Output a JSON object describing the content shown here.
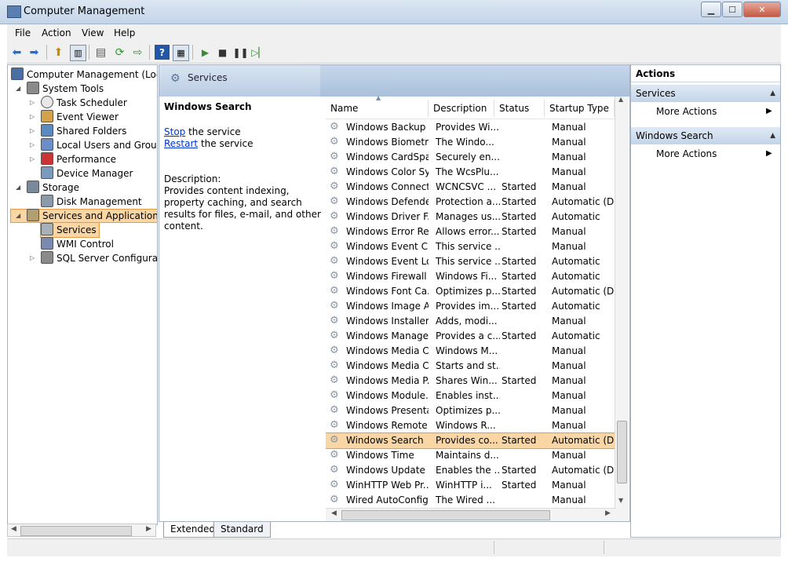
{
  "window": {
    "title": "Computer Management"
  },
  "menu": [
    "File",
    "Action",
    "View",
    "Help"
  ],
  "tree": {
    "items": [
      {
        "label": "Computer Management (Local",
        "icon": "computer-icon",
        "depth": 0,
        "expander": "none"
      },
      {
        "label": "System Tools",
        "icon": "tools-icon",
        "depth": 1,
        "expander": "expanded"
      },
      {
        "label": "Task Scheduler",
        "icon": "clock-icon",
        "depth": 2,
        "expander": "collapsed"
      },
      {
        "label": "Event Viewer",
        "icon": "event-viewer-icon",
        "depth": 2,
        "expander": "collapsed"
      },
      {
        "label": "Shared Folders",
        "icon": "shared-folder-icon",
        "depth": 2,
        "expander": "collapsed"
      },
      {
        "label": "Local Users and Groups",
        "icon": "users-icon",
        "depth": 2,
        "expander": "collapsed"
      },
      {
        "label": "Performance",
        "icon": "performance-icon",
        "depth": 2,
        "expander": "collapsed"
      },
      {
        "label": "Device Manager",
        "icon": "device-manager-icon",
        "depth": 2,
        "expander": "none"
      },
      {
        "label": "Storage",
        "icon": "storage-icon",
        "depth": 1,
        "expander": "expanded"
      },
      {
        "label": "Disk Management",
        "icon": "disk-icon",
        "depth": 2,
        "expander": "none"
      },
      {
        "label": "Services and Applications",
        "icon": "services-apps-icon",
        "depth": 1,
        "expander": "expanded",
        "highlight": true
      },
      {
        "label": "Services",
        "icon": "services-icon",
        "depth": 2,
        "expander": "none",
        "selected": true
      },
      {
        "label": "WMI Control",
        "icon": "wmi-icon",
        "depth": 2,
        "expander": "none"
      },
      {
        "label": "SQL Server Configuratic",
        "icon": "sql-icon",
        "depth": 2,
        "expander": "collapsed"
      }
    ]
  },
  "center": {
    "header_title": "Services",
    "selected_service": "Windows Search",
    "stop_link": "Stop",
    "stop_suffix": " the service",
    "restart_link": "Restart",
    "restart_suffix": " the service",
    "description_label": "Description:",
    "description_text": "Provides content indexing, property caching, and search results for files, e-mail, and other content."
  },
  "columns": [
    "Name",
    "Description",
    "Status",
    "Startup Type"
  ],
  "services": [
    {
      "name": "Windows Backup",
      "desc": "Provides Wi...",
      "status": "",
      "startup": "Manual"
    },
    {
      "name": "Windows Biometri...",
      "desc": "The Windo...",
      "status": "",
      "startup": "Manual"
    },
    {
      "name": "Windows CardSpa...",
      "desc": "Securely en...",
      "status": "",
      "startup": "Manual"
    },
    {
      "name": "Windows Color Sy...",
      "desc": "The WcsPlu...",
      "status": "",
      "startup": "Manual"
    },
    {
      "name": "Windows Connect...",
      "desc": "WCNCSVC ...",
      "status": "Started",
      "startup": "Manual"
    },
    {
      "name": "Windows Defender",
      "desc": "Protection a...",
      "status": "Started",
      "startup": "Automatic (D..."
    },
    {
      "name": "Windows Driver F...",
      "desc": "Manages us...",
      "status": "Started",
      "startup": "Automatic"
    },
    {
      "name": "Windows Error Re...",
      "desc": "Allows error...",
      "status": "Started",
      "startup": "Manual"
    },
    {
      "name": "Windows Event C...",
      "desc": "This service ...",
      "status": "",
      "startup": "Manual"
    },
    {
      "name": "Windows Event Log",
      "desc": "This service ...",
      "status": "Started",
      "startup": "Automatic"
    },
    {
      "name": "Windows Firewall",
      "desc": "Windows Fi...",
      "status": "Started",
      "startup": "Automatic"
    },
    {
      "name": "Windows Font Ca...",
      "desc": "Optimizes p...",
      "status": "Started",
      "startup": "Automatic (D..."
    },
    {
      "name": "Windows Image A...",
      "desc": "Provides im...",
      "status": "Started",
      "startup": "Automatic"
    },
    {
      "name": "Windows Installer",
      "desc": "Adds, modi...",
      "status": "",
      "startup": "Manual"
    },
    {
      "name": "Windows Manage...",
      "desc": "Provides a c...",
      "status": "Started",
      "startup": "Automatic"
    },
    {
      "name": "Windows Media C...",
      "desc": "Windows M...",
      "status": "",
      "startup": "Manual"
    },
    {
      "name": "Windows Media C...",
      "desc": "Starts and st...",
      "status": "",
      "startup": "Manual"
    },
    {
      "name": "Windows Media P...",
      "desc": "Shares Win...",
      "status": "Started",
      "startup": "Manual"
    },
    {
      "name": "Windows Module...",
      "desc": "Enables inst...",
      "status": "",
      "startup": "Manual"
    },
    {
      "name": "Windows Presenta...",
      "desc": "Optimizes p...",
      "status": "",
      "startup": "Manual"
    },
    {
      "name": "Windows Remote ...",
      "desc": "Windows R...",
      "status": "",
      "startup": "Manual"
    },
    {
      "name": "Windows Search",
      "desc": "Provides co...",
      "status": "Started",
      "startup": "Automatic (D...",
      "selected": true
    },
    {
      "name": "Windows Time",
      "desc": "Maintains d...",
      "status": "",
      "startup": "Manual"
    },
    {
      "name": "Windows Update",
      "desc": "Enables the ...",
      "status": "Started",
      "startup": "Automatic (D..."
    },
    {
      "name": "WinHTTP Web Pr...",
      "desc": "WinHTTP i...",
      "status": "Started",
      "startup": "Manual"
    },
    {
      "name": "Wired AutoConfig",
      "desc": "The Wired ...",
      "status": "",
      "startup": "Manual"
    }
  ],
  "bottom_tabs": [
    "Extended",
    "Standard"
  ],
  "actions": {
    "title": "Actions",
    "sections": [
      {
        "header": "Services",
        "item": "More Actions"
      },
      {
        "header": "Windows Search",
        "item": "More Actions"
      }
    ]
  }
}
